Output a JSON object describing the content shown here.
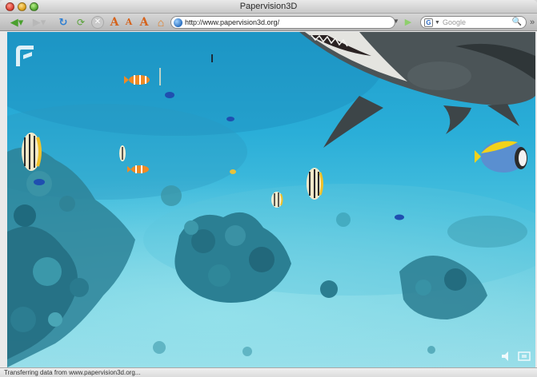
{
  "window": {
    "title": "Papervision3D"
  },
  "toolbar": {
    "address": "http://www.papervision3d.org/",
    "search_placeholder": "Google",
    "search_engine_badge": "G",
    "font_size_labels": [
      "A",
      "A",
      "A"
    ]
  },
  "status": {
    "text": "Transferring data from www.papervision3d.org..."
  },
  "icons": {
    "back": "arrow-left-icon",
    "forward": "arrow-right-icon",
    "reload": "reload-icon",
    "new_tab": "new-tab-icon",
    "stop": "stop-icon",
    "home": "home-icon",
    "go": "play-icon",
    "search": "magnifier-icon"
  },
  "colors": {
    "water_top": "#1e9dcc",
    "water_bottom": "#9adde8",
    "reef": "#2c7f92"
  }
}
